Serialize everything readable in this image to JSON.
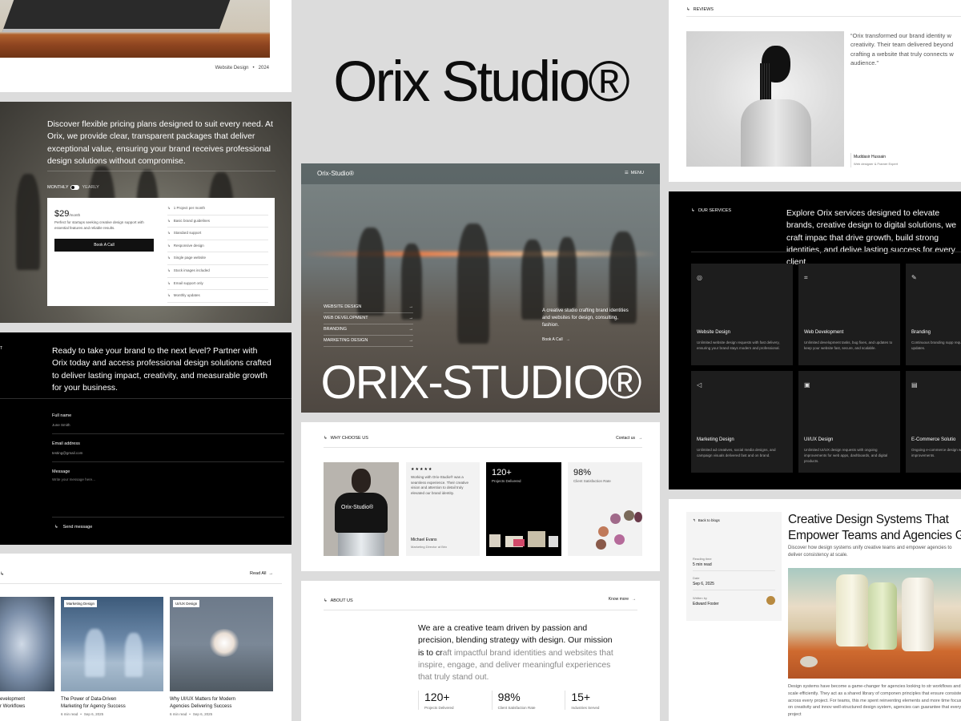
{
  "brand": {
    "title": "Orix Studio®",
    "logo_small": "Orix-Studio®",
    "hero_word": "ORIX-STUDIO®"
  },
  "portfolio": {
    "meta_category": "Website Design",
    "meta_year": "2024"
  },
  "pricing": {
    "intro": "Discover flexible pricing plans designed to suit every need. At Orix, we provide clear, transparent packages that deliver exceptional value, ensuring your brand receives professional design solutions without compromise.",
    "toggle_monthly": "MONTHLY",
    "toggle_yearly": "YEARLY",
    "price": "$29",
    "period": "/month",
    "plan_desc": "Perfect for startups seeking creative design support with essential features and reliable results.",
    "cta": "Book A Call",
    "features": [
      "1 Project per month",
      "Basic brand guidelines",
      "Standard support",
      "Responsive design",
      "Single page website",
      "Stock images included",
      "Email support only",
      "Monthly updates"
    ]
  },
  "contact": {
    "corner": "T",
    "intro": "Ready to take your brand to the next level? Partner with Orix today and access professional design solutions crafted to deliver lasting impact, creativity, and measurable growth for your business.",
    "name_label": "Full name",
    "name_value": "June Smith",
    "email_label": "Email address",
    "email_value": "testing@gmail.com",
    "message_label": "Message",
    "message_placeholder": "Write your message here...",
    "send": "Send message"
  },
  "blog_list": {
    "read_all": "Read All",
    "posts": [
      {
        "tag": "",
        "title_1": "evelopment",
        "title_2": "r Workflows"
      },
      {
        "tag": "Marketing Design",
        "title_1": "The Power of Data-Driven",
        "title_2": "Marketing for Agency Success",
        "read": "6 min read",
        "date": "Sep 6, 2025"
      },
      {
        "tag": "UI/UX Design",
        "title_1": "Why UI/UX Matters for Modern",
        "title_2": "Agencies Delivering Success",
        "read": "6 min read",
        "date": "Sep 6, 2025"
      }
    ]
  },
  "hero": {
    "menu": "MENU",
    "nav": [
      "WEBSITE DESIGN",
      "WEB DEVELOPMENT",
      "BRANDING",
      "MARKETING DESIGN"
    ],
    "tagline": "A creative studio crafting brand identities and websites for design, consulting, fashion.",
    "cta": "Book A Call"
  },
  "why": {
    "label": "WHY CHOOSE US",
    "contact": "Contact us",
    "stars": "★★★★★",
    "quote": "Working with Orix-Studio® was a seamless experience. Their creative vision and attention to detail truly elevated our brand identity.",
    "author": "Michael Evans",
    "author_role": "Marketing Director at Brix",
    "shirt": "Orix-Studio®",
    "stat1_value": "120+",
    "stat1_label": "Projects Delivered",
    "stat2_value": "98%",
    "stat2_label": "Client Satisfaction Rate"
  },
  "about": {
    "label": "ABOUT US",
    "more": "Know more",
    "text_dark": "We are a creative team driven by passion and precision, blending strategy with design. Our mission is to cr",
    "text_light": "aft impactful brand identities and websites that inspire, engage, and deliver meaningful experiences that truly stand out.",
    "stats": [
      {
        "value": "120+",
        "label": "Projects Delivered"
      },
      {
        "value": "98%",
        "label": "Client Satisfaction Rate"
      },
      {
        "value": "15+",
        "label": "Industries Served"
      }
    ]
  },
  "reviews": {
    "label": "REVIEWS",
    "quote": "“Orix transformed our brand identity w creativity. Their team delivered beyond crafting a website that truly connects w audience.”",
    "author": "Muddasir Hussain",
    "role": "Web designer & Framer Expert"
  },
  "services": {
    "label": "OUR SERVICES",
    "intro": "Explore Orix services designed to elevate brands, creative design to digital solutions, we craft impac that drive growth, build strong identities, and delive lasting success for every client.",
    "items": [
      {
        "icon": "globe-icon",
        "title": "Website Design",
        "desc": "Unlimited website design requests with fast delivery, ensuring your brand stays modern and professional."
      },
      {
        "icon": "code-icon",
        "title": "Web Development",
        "desc": "Unlimited development tasks, bug fixes, and updates to keep your website fast, secure, and scalable."
      },
      {
        "icon": "brush-icon",
        "title": "Branding",
        "desc": "Continuous branding supp requests for logos, guideline updates."
      },
      {
        "icon": "megaphone-icon",
        "title": "Marketing Design",
        "desc": "Unlimited ad creatives, social media designs, and campaign visuals delivered fast and on brand."
      },
      {
        "icon": "layers-icon",
        "title": "UI/UX Design",
        "desc": "Unlimited UI/UX design requests with ongoing improvements for web apps, dashboards, and digital products."
      },
      {
        "icon": "bag-icon",
        "title": "E-Commerce Solutio",
        "desc": "Ongoing e-commerce design with unlimited requests fo improvements."
      }
    ]
  },
  "article": {
    "back": "Back to blogs",
    "reading_label": "Reading time",
    "reading_value": "5 min read",
    "date_label": "Date",
    "date_value": "Sep 6, 2025",
    "author_label": "Written by",
    "author_value": "Edward Foster",
    "title": "Creative Design Systems That Empower Teams and Agencies G",
    "subtitle": "Discover how design systems unify creative teams and empower agencies to deliver consistency at scale.",
    "body": "Design systems have become a game-changer for agencies looking to str workflows and scale efficiently. They act as a shared library of componen principles that ensure consistency across every project. For teams, this me spent reinventing elements and more time focusing on creativity and innov well-structured design system, agencies can guarantee that every project"
  }
}
